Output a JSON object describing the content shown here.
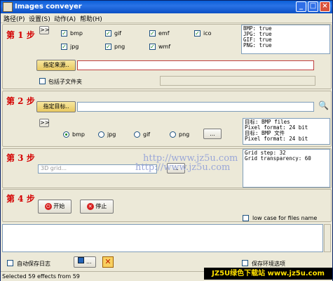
{
  "window": {
    "title": "Images conveyer",
    "min": "_",
    "max": "□",
    "close": "×"
  },
  "menu": [
    "路径(P)",
    "设置(S)",
    "动作(A)",
    "帮助(H)"
  ],
  "steps": [
    "第 1 步",
    "第 2 步",
    "第 3 步",
    "第 4 步"
  ],
  "step1": {
    "expand_label": ">>",
    "formats": [
      {
        "label": "bmp",
        "checked": true
      },
      {
        "label": "gif",
        "checked": true
      },
      {
        "label": "emf",
        "checked": true
      },
      {
        "label": "ico",
        "checked": true
      },
      {
        "label": "jpg",
        "checked": true
      },
      {
        "label": "png",
        "checked": true
      },
      {
        "label": "wmf",
        "checked": true
      }
    ],
    "info": "BMP: true\nJPG: true\nGIF: true\nPNG: true",
    "source_button": "指定来源..",
    "source_value": "",
    "subfolders_label": "包括子文件夹"
  },
  "step2": {
    "target_button": "指定目标..",
    "target_value": "",
    "expand_label": ">>",
    "formats": [
      {
        "label": "bmp",
        "selected": true
      },
      {
        "label": "jpg",
        "selected": false
      },
      {
        "label": "gif",
        "selected": false
      },
      {
        "label": "png",
        "selected": false
      }
    ],
    "settings_button": "...",
    "info": "目标: BMP files\nPixel format: 24 bit\n目标: BMP 文件\nPixel format: 24 bit"
  },
  "step3": {
    "effect_placeholder": "3D grid...",
    "info": "Grid step: 32\nGrid transparency: 60"
  },
  "step4": {
    "start_label": "开始",
    "stop_label": "停止",
    "lowercase_label": "low case for files name"
  },
  "bottom": {
    "autosave_label": "自动保存日志",
    "save_button": "...",
    "save_env_label": "保存环境选项"
  },
  "status": {
    "text": "Selected 59 effects from 59"
  },
  "watermarks": [
    "http://www.jz5u.com",
    "http://www.jz5u.com"
  ],
  "banner": "JZ5U绿色下载站 www.jz5u.com"
}
